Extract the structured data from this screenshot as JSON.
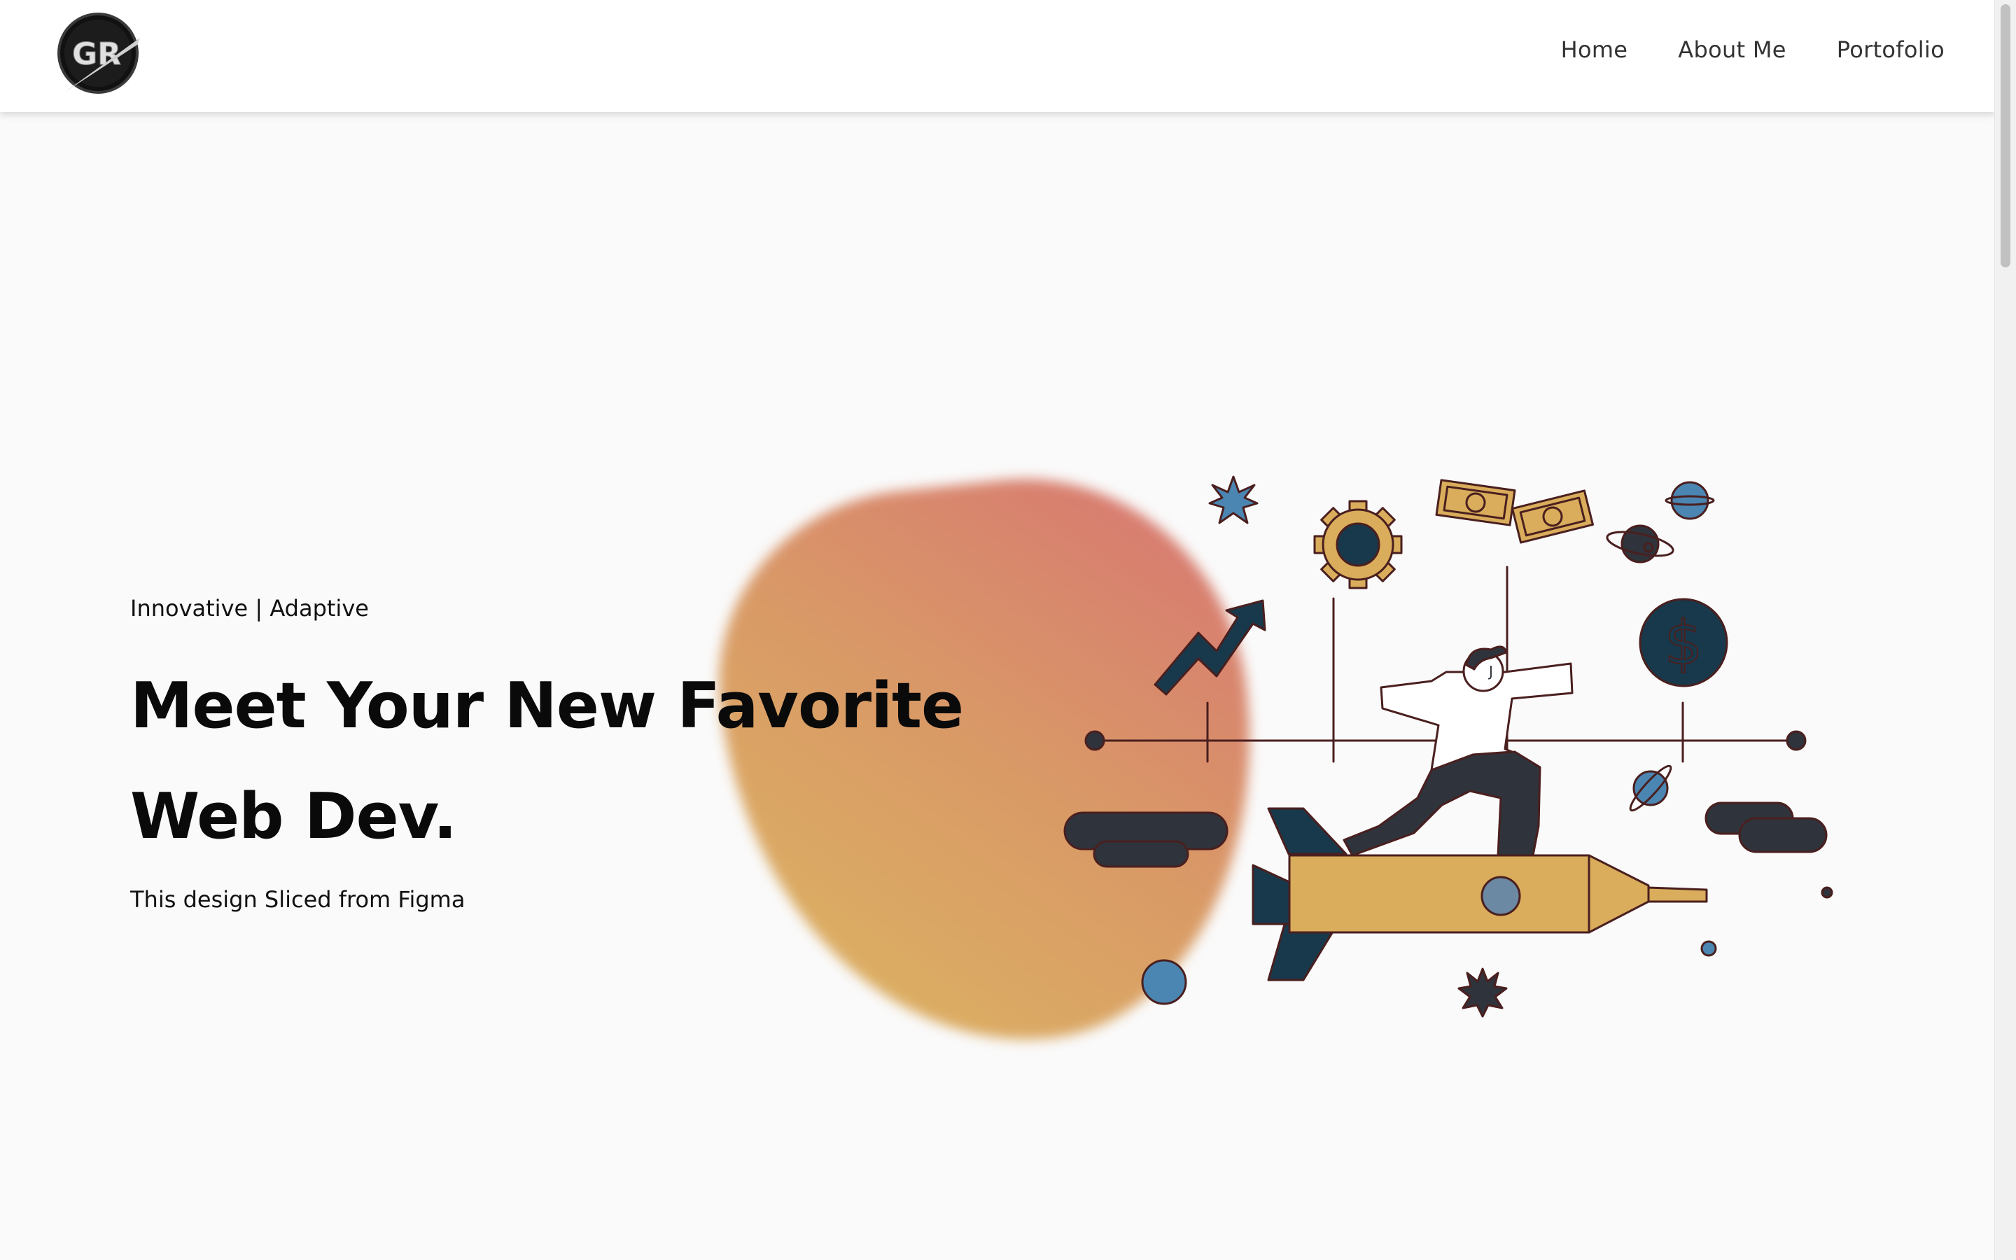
{
  "header": {
    "logo_text": "GR",
    "nav": [
      {
        "label": "Home"
      },
      {
        "label": "About Me"
      },
      {
        "label": "Portofolio"
      }
    ]
  },
  "hero": {
    "tagline": "Innovative | Adaptive",
    "title": "Meet Your New Favorite Web Dev.",
    "subtitle": "This design Sliced from Figma"
  },
  "illustration": {
    "badge_letter": "J",
    "currency_symbol": "$"
  },
  "colors": {
    "background": "#fafafa",
    "nav_text": "#333333",
    "heading": "#0a0a0a",
    "blob_start": "#dcb462",
    "blob_end": "#d87872",
    "mustard": "#d9ad5b",
    "navy": "#18394b",
    "steel_blue": "#4b86b2",
    "outline": "#4a1f1f",
    "charcoal": "#2f333b"
  },
  "icons": {
    "logo": "gr-logo-icon",
    "rocket": "rocket-icon",
    "gear": "gear-icon",
    "money": "money-bills-icon",
    "coin": "dollar-coin-icon",
    "chart": "trend-arrow-icon",
    "planet": "planet-icon",
    "star": "star-icon"
  }
}
